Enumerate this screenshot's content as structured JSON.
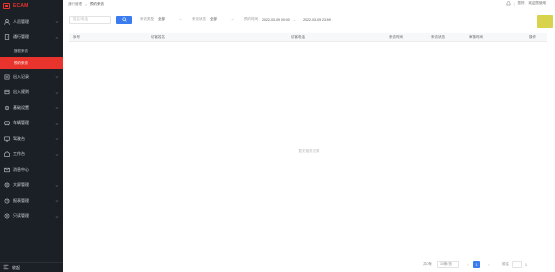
{
  "app": {
    "logo_text": "ECAM"
  },
  "sidebar": {
    "items": [
      {
        "label": "人员管理",
        "icon": "user-icon"
      },
      {
        "label": "通行管理",
        "icon": "door-icon",
        "expanded": true,
        "children": [
          {
            "label": "授权来访"
          },
          {
            "label": "预约来访",
            "active": true
          }
        ]
      },
      {
        "label": "出入记录",
        "icon": "record-icon"
      },
      {
        "label": "出入规则",
        "icon": "rule-icon"
      },
      {
        "label": "基础设置",
        "icon": "settings-icon"
      },
      {
        "label": "车辆管理",
        "icon": "car-icon"
      },
      {
        "label": "驾驶台",
        "icon": "monitor-icon"
      },
      {
        "label": "工作台",
        "icon": "workbench-icon"
      },
      {
        "label": "消息中心",
        "icon": "message-icon"
      },
      {
        "label": "大屏管理",
        "icon": "screen-icon"
      },
      {
        "label": "报表管理",
        "icon": "report-icon"
      },
      {
        "label": "只读管理",
        "icon": "readonly-icon"
      }
    ],
    "footer_label": "收起"
  },
  "header": {
    "breadcrumb": [
      "通行管理",
      "预约来访"
    ],
    "user_links": [
      "您好,",
      "欢迎您使用"
    ]
  },
  "filters": {
    "name_placeholder": "姓名/电话",
    "type_label": "来访类型",
    "type_value": "全部",
    "status_label": "来访状态",
    "status_value": "全部",
    "date_label": "预约时间",
    "date_from": "2022-03-09 00:00",
    "date_to": "2022-03-09 23:59"
  },
  "table": {
    "columns": [
      "序号",
      "访客姓名",
      "访客电话",
      "来访时间",
      "来访状态",
      "审核时间",
      "操作"
    ],
    "rows": [],
    "empty_text": "暂无相关记录"
  },
  "pager": {
    "total": "共0条",
    "page_size": "10条/页",
    "pages": [
      "1"
    ],
    "current_page": "1",
    "goto_label": "前往",
    "goto_value": "1",
    "goto_suffix": "页"
  },
  "colors": {
    "sidebar_bg": "#1b1f26",
    "accent_red": "#e8342d",
    "primary_blue": "#3a7cf0",
    "action_yellow": "#d9d24c"
  }
}
